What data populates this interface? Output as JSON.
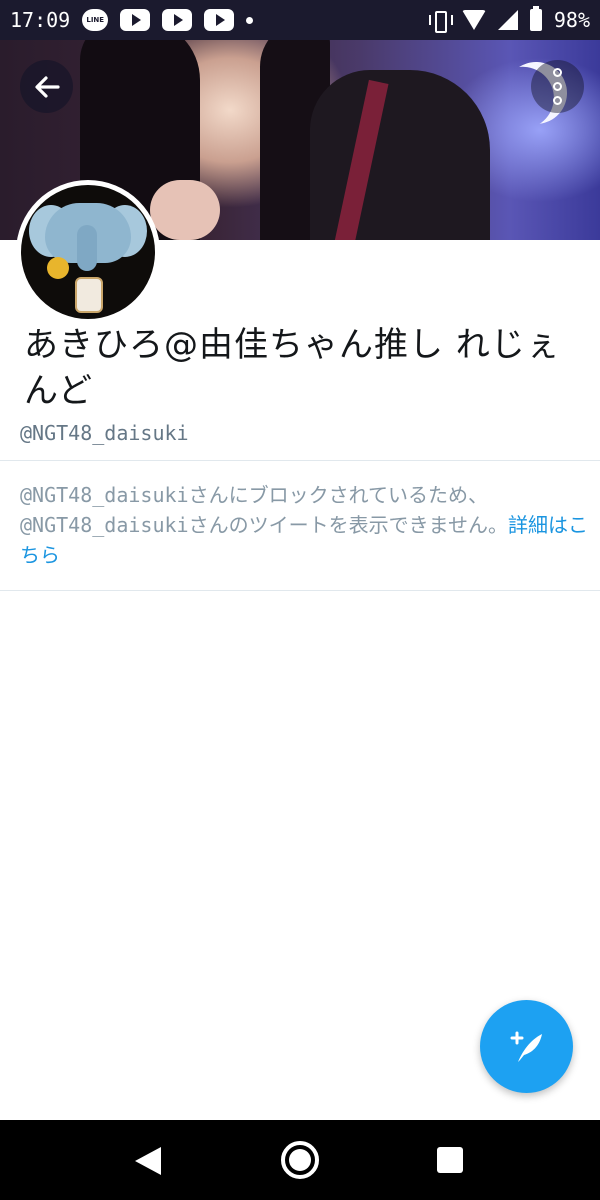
{
  "status_bar": {
    "time": "17:09",
    "battery": "98%",
    "notification_icons": [
      "line-icon",
      "youtube-icon",
      "youtube-icon",
      "youtube-icon",
      "dot-icon"
    ],
    "system_icons": [
      "vibrate-icon",
      "wifi-icon",
      "signal-icon",
      "battery-icon"
    ],
    "line_label": "LINE"
  },
  "header": {
    "back_icon": "arrow-left-icon",
    "more_icon": "more-vertical-icon"
  },
  "profile": {
    "display_name": "あきひろ@由佳ちゃん推し れじぇんど",
    "handle": "@NGT48_daisuki"
  },
  "blocked_notice": {
    "text": "@NGT48_daisukiさんにブロックされているため、@NGT48_daisukiさんのツイートを表示できません。",
    "link": "詳細はこちら"
  },
  "compose": {
    "icon": "compose-tweet-icon"
  },
  "navigation": {
    "icons": [
      "back-triangle-icon",
      "home-circle-icon",
      "recents-square-icon"
    ]
  },
  "colors": {
    "accent": "#1da1f2",
    "link": "#1b95e0",
    "secondary_text": "#657786",
    "status_bar": "#1b1a2e"
  }
}
